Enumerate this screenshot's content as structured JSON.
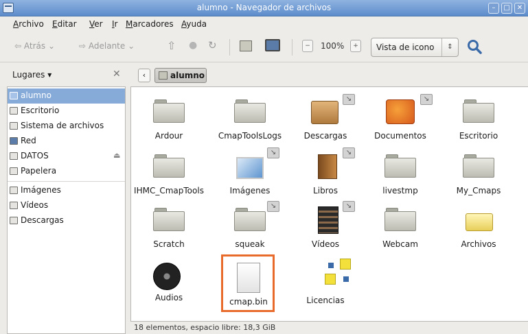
{
  "window": {
    "title": "alumno - Navegador de archivos"
  },
  "menu": [
    "Archivo",
    "Editar",
    "Ver",
    "Ir",
    "Marcadores",
    "Ayuda"
  ],
  "toolbar": {
    "back": "Atrás",
    "forward": "Adelante",
    "zoom": "100%",
    "view_mode": "Vista de icono"
  },
  "sidebar": {
    "header": "Lugares",
    "items": [
      {
        "label": "alumno",
        "icon": "home-folder-icon"
      },
      {
        "label": "Escritorio",
        "icon": "desktop-folder-icon"
      },
      {
        "label": "Sistema de archivos",
        "icon": "drive-icon"
      },
      {
        "label": "Red",
        "icon": "network-icon"
      },
      {
        "label": "DATOS",
        "icon": "drive-icon"
      },
      {
        "label": "Papelera",
        "icon": "trash-icon"
      },
      {
        "label": "Imágenes",
        "icon": "folder-icon"
      },
      {
        "label": "Vídeos",
        "icon": "folder-icon"
      },
      {
        "label": "Descargas",
        "icon": "folder-icon"
      }
    ]
  },
  "path": {
    "current": "alumno"
  },
  "files": [
    {
      "name": "Ardour",
      "icon": "folder-icon"
    },
    {
      "name": "CmapToolsLogs",
      "icon": "folder-icon"
    },
    {
      "name": "Descargas",
      "icon": "downloads-folder-icon"
    },
    {
      "name": "Documentos",
      "icon": "documents-folder-icon"
    },
    {
      "name": "Escritorio",
      "icon": "desktop-folder-icon"
    },
    {
      "name": "IHMC_CmapTools",
      "icon": "folder-icon"
    },
    {
      "name": "Imágenes",
      "icon": "pictures-folder-icon"
    },
    {
      "name": "Libros",
      "icon": "books-folder-icon"
    },
    {
      "name": "livestmp",
      "icon": "folder-icon"
    },
    {
      "name": "My_Cmaps",
      "icon": "folder-icon"
    },
    {
      "name": "Scratch",
      "icon": "folder-icon"
    },
    {
      "name": "squeak",
      "icon": "folder-icon"
    },
    {
      "name": "Vídeos",
      "icon": "videos-folder-icon"
    },
    {
      "name": "Webcam",
      "icon": "folder-icon"
    },
    {
      "name": "Archivos",
      "icon": "open-folder-icon"
    },
    {
      "name": "Audios",
      "icon": "music-folder-icon"
    },
    {
      "name": "cmap.bin",
      "icon": "file-icon"
    },
    {
      "name": "Licencias",
      "icon": "license-file-icon"
    }
  ],
  "status": "18 elementos, espacio libre: 18,3 GiB",
  "colors": {
    "selection": "#86abd9",
    "highlight": "#e96b2c",
    "titlebar": "#6f98d0"
  }
}
